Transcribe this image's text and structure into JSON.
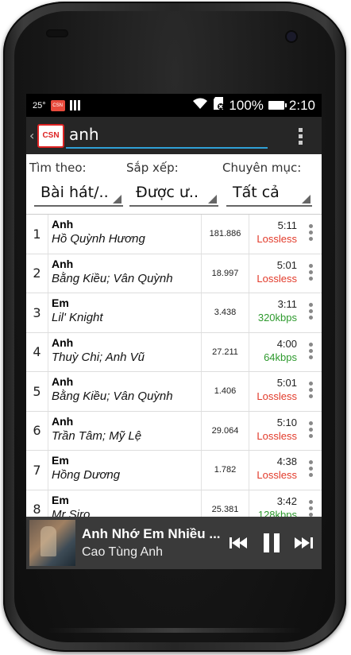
{
  "status_bar": {
    "temperature": "25°",
    "battery": "100%",
    "time": "2:10"
  },
  "action_bar": {
    "logo_text": "CSN",
    "search_value": "anh"
  },
  "filters": {
    "search_by": {
      "label": "Tìm theo:",
      "value": "Bài hát/.."
    },
    "sort": {
      "label": "Sắp xếp:",
      "value": "Được ư.."
    },
    "category": {
      "label": "Chuyên mục:",
      "value": "Tất cả"
    }
  },
  "songs": [
    {
      "index": "1",
      "title": "Anh",
      "artist": "Hồ Quỳnh Hương",
      "plays": "181.886",
      "duration": "5:11",
      "quality": "Lossless"
    },
    {
      "index": "2",
      "title": "Anh",
      "artist": "Bằng Kiều; Vân Quỳnh",
      "plays": "18.997",
      "duration": "5:01",
      "quality": "Lossless"
    },
    {
      "index": "3",
      "title": "Em",
      "artist": "Lil' Knight",
      "plays": "3.438",
      "duration": "3:11",
      "quality": "320kbps"
    },
    {
      "index": "4",
      "title": "Anh",
      "artist": "Thuỳ Chi; Anh Vũ",
      "plays": "27.211",
      "duration": "4:00",
      "quality": "64kbps"
    },
    {
      "index": "5",
      "title": "Anh",
      "artist": "Bằng Kiều; Vân Quỳnh",
      "plays": "1.406",
      "duration": "5:01",
      "quality": "Lossless"
    },
    {
      "index": "6",
      "title": "Anh",
      "artist": "Trần Tâm; Mỹ Lệ",
      "plays": "29.064",
      "duration": "5:10",
      "quality": "Lossless"
    },
    {
      "index": "7",
      "title": "Em",
      "artist": "Hồng Dương",
      "plays": "1.782",
      "duration": "4:38",
      "quality": "Lossless"
    },
    {
      "index": "8",
      "title": "Em",
      "artist": "Mr Siro",
      "plays": "25.381",
      "duration": "3:42",
      "quality": "128kbps"
    }
  ],
  "now_playing": {
    "title": "Anh Nhớ Em Nhiều ...",
    "artist": "Cao Tùng Anh"
  },
  "colors": {
    "lossless": "#e23a2a",
    "kbps": "#2e9a2e",
    "accent": "#2fa0d6"
  }
}
